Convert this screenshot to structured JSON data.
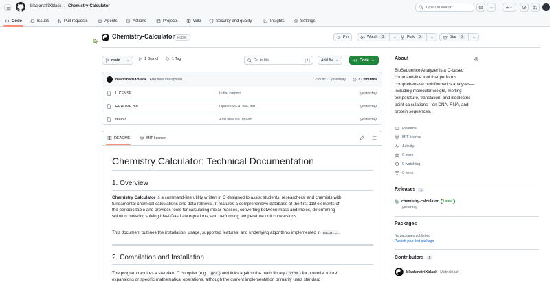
{
  "header": {
    "owner": "blackmatriXblack",
    "separator": "/",
    "repo": "Chemistry-Calculator",
    "search_placeholder": "Type / to search",
    "plus_label": "+"
  },
  "tabs": [
    {
      "label": "Code",
      "icon": "code-icon"
    },
    {
      "label": "Issues",
      "icon": "issue-icon"
    },
    {
      "label": "Pull requests",
      "icon": "pull-request-icon"
    },
    {
      "label": "Agents",
      "icon": "agent-icon"
    },
    {
      "label": "Actions",
      "icon": "actions-icon"
    },
    {
      "label": "Projects",
      "icon": "projects-icon"
    },
    {
      "label": "Wiki",
      "icon": "wiki-icon"
    },
    {
      "label": "Security and quality",
      "icon": "shield-icon"
    },
    {
      "label": "Insights",
      "icon": "graph-icon"
    },
    {
      "label": "Settings",
      "icon": "gear-icon"
    }
  ],
  "repo": {
    "title": "Chemistry-Calculator",
    "visibility": "Public",
    "pin_label": "Pin",
    "watch_label": "Watch",
    "watch_count": "0",
    "fork_label": "Fork",
    "fork_count": "0",
    "star_label": "Star",
    "star_count": "0"
  },
  "toolbar": {
    "branch": "main",
    "branches": "1 Branch",
    "tags": "1 Tag",
    "goto_placeholder": "Go to file",
    "goto_key": "t",
    "add_file": "Add file",
    "code_button": "Code"
  },
  "commit": {
    "author": "blackmatriXblack",
    "message": "Add files via upload",
    "hash_time": "25d0ac7 · yesterday",
    "commits": "3 Commits"
  },
  "files": [
    {
      "name": "LICENSE",
      "message": "Initial commit",
      "time": "yesterday"
    },
    {
      "name": "README.md",
      "message": "Update README.md",
      "time": "yesterday"
    },
    {
      "name": "main.c",
      "message": "Add files via upload",
      "time": "yesterday"
    }
  ],
  "readme": {
    "tab_readme": "README",
    "tab_license": "MIT license",
    "h1": "Chemistry Calculator: Technical Documentation",
    "h2_overview": "1. Overview",
    "p1_bold": "Chemistry Calculator",
    "p1_l1": " is a command-line utility written in C designed to assist students, researchers, and chemists with",
    "p1_l2": "fundamental chemical calculations and data retrieval. It features a comprehensive database of the first 118 elements of",
    "p1_l3": "the periodic table and provides tools for calculating molar masses, converting between mass and moles, determining",
    "p1_l4": "solution molarity, solving Ideal Gas Law equations, and performing temperature unit conversions.",
    "p2": "This document outlines the installation, usage, supported features, and underlying algorithms implemented in",
    "p2_code": "main.c",
    "p2_end": ".",
    "h2_compile": "2. Compilation and Installation",
    "p3_a": "The program requires a standard C compiler (e.g.,",
    "p3_code1": "gcc",
    "p3_b": ") and links against the math library (",
    "p3_code2": "libm",
    "p3_c": ") for potential future",
    "p3_l2": "expansions or specific mathematical operations, although the current implementation primarily uses standard"
  },
  "about": {
    "heading": "About",
    "description": "BioSequence Analyzer is a C-based command-line tool that performs comprehensive bioinformatics analyses—including molecular weight, melting temperature, translation, and isoelectric point calculations—on DNA, RNA, and protein sequences.",
    "items": [
      {
        "label": "Readme",
        "icon": "book-icon"
      },
      {
        "label": "MIT license",
        "icon": "law-icon"
      },
      {
        "label": "Activity",
        "icon": "pulse-icon"
      },
      {
        "label": "0 stars",
        "icon": "star-icon"
      },
      {
        "label": "0 watching",
        "icon": "eye-icon"
      },
      {
        "label": "0 forks",
        "icon": "fork-icon"
      }
    ]
  },
  "releases": {
    "heading": "Releases",
    "count": "1",
    "tag": "chemistry-calculator",
    "badge": "Latest",
    "time": "yesterday"
  },
  "packages": {
    "heading": "Packages",
    "none": "No packages published",
    "link": "Publish your first package"
  },
  "contributors": {
    "heading": "Contributors",
    "count": "1",
    "name": "blackmatriXblack",
    "handle": "Matrixblack"
  },
  "colors": {
    "accent_green": "#1f883d",
    "link_blue": "#0969da",
    "tab_underline": "#fd8c73"
  }
}
